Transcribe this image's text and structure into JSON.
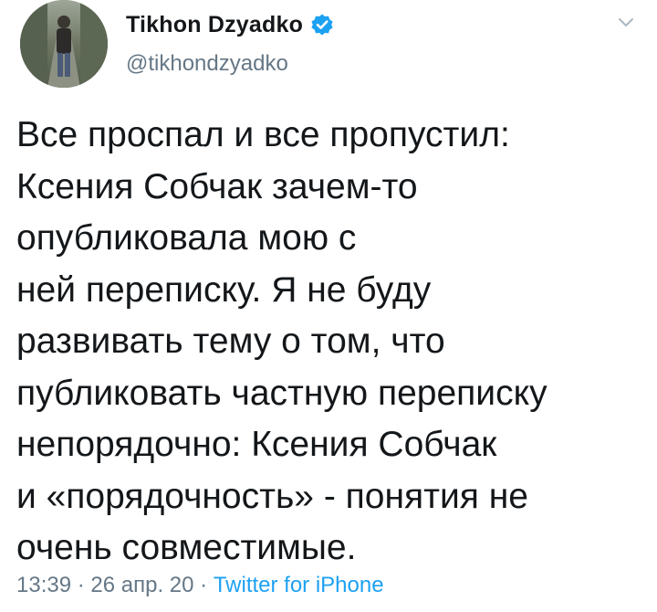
{
  "author": {
    "display_name": "Tikhon Dzyadko",
    "handle": "@tikhondzyadko",
    "verified": true
  },
  "tweet": {
    "lines": [
      "Все проспал и все пропустил:",
      "Ксения Собчак зачем-то",
      "опубликовала мою с",
      "ней переписку. Я не буду",
      "развивать тему о том, что",
      "публиковать частную переписку",
      "непорядочно: Ксения Собчак",
      "и «порядочность» - понятия не",
      "очень совместимые."
    ]
  },
  "meta": {
    "time": "13:39",
    "separator": " · ",
    "date": "26 апр. 20",
    "source": "Twitter for iPhone"
  },
  "icons": {
    "verified": "verified-badge-icon",
    "menu": "chevron-down-icon"
  },
  "colors": {
    "text": "#14171a",
    "secondary": "#657786",
    "accent": "#1da1f2"
  }
}
